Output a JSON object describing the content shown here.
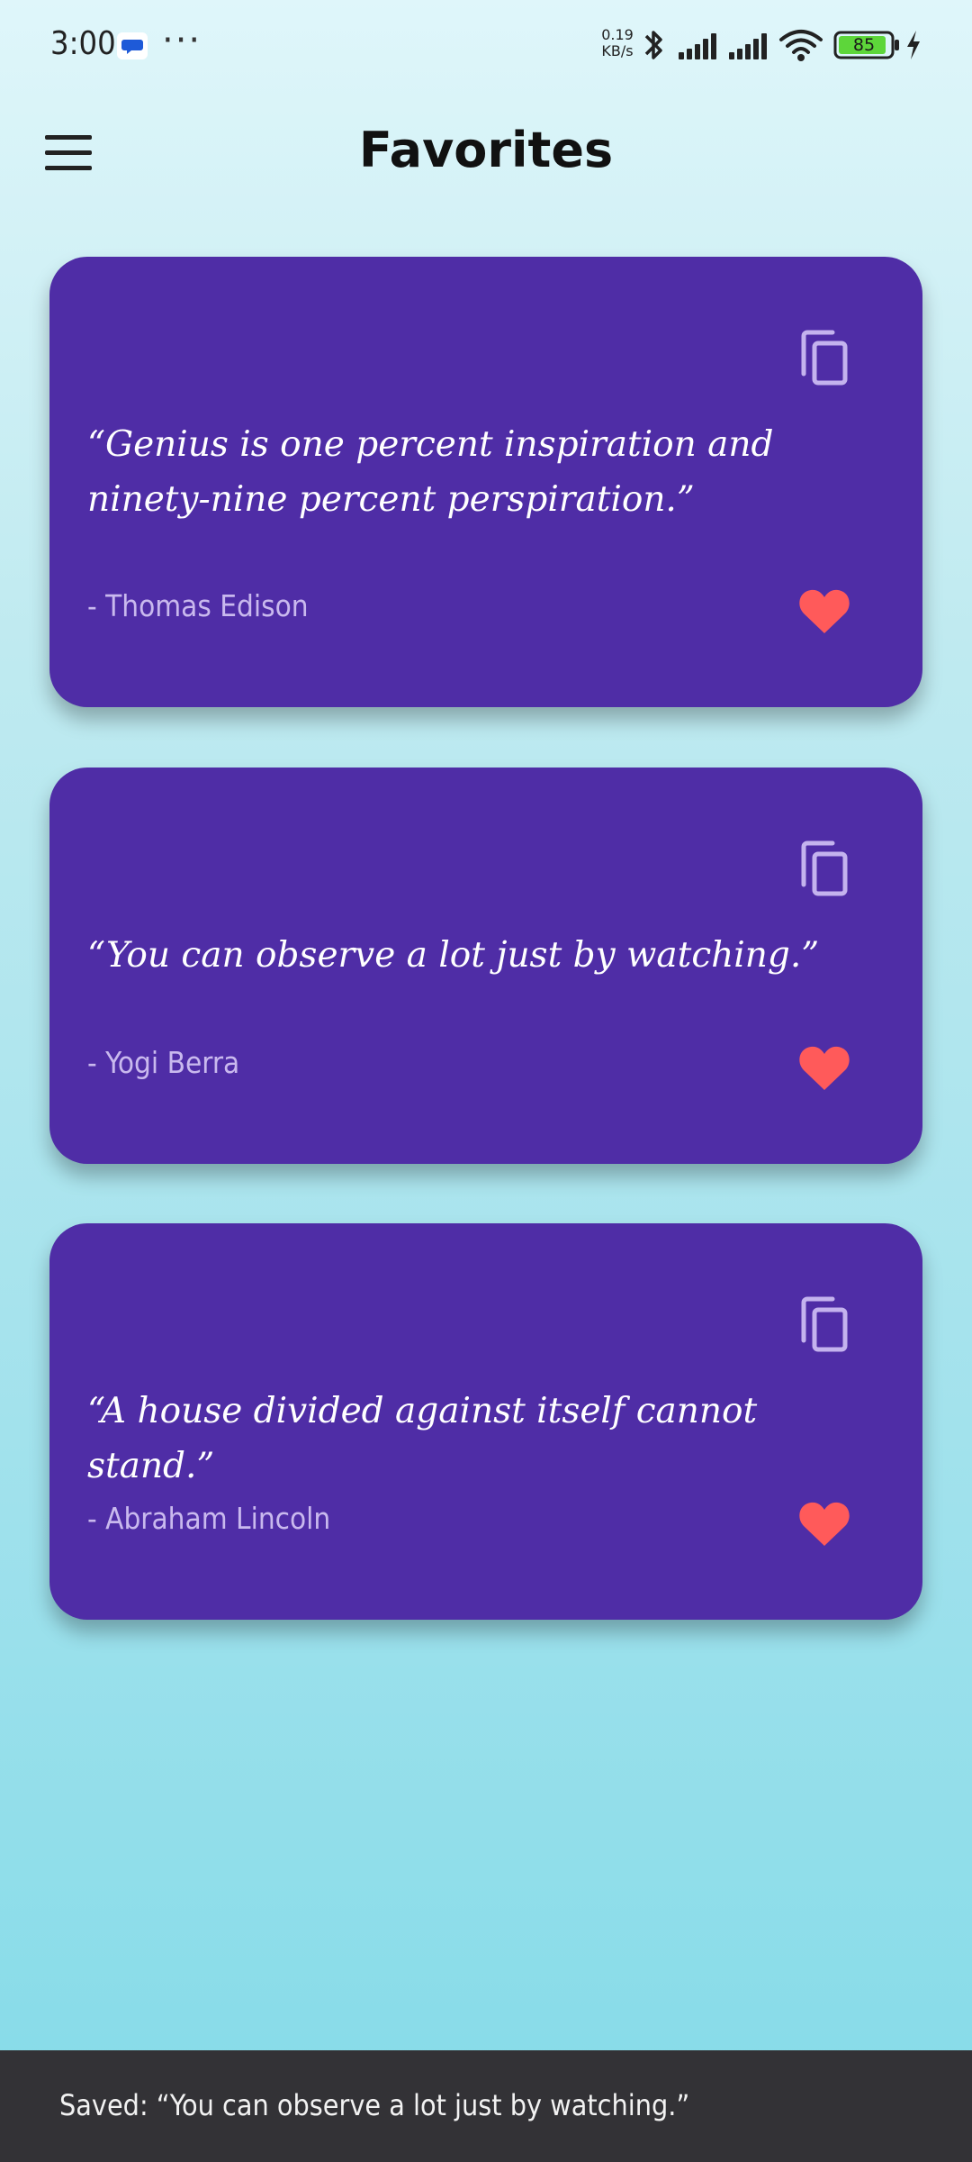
{
  "status_bar": {
    "time": "3:00",
    "more": "···",
    "net_speed_value": "0.19",
    "net_speed_unit": "KB/s",
    "battery": "85",
    "icons": [
      "chat-notification-icon",
      "bluetooth-icon",
      "signal-icon",
      "signal-icon",
      "wifi-icon",
      "battery-icon",
      "charging-icon"
    ]
  },
  "app_bar": {
    "title": "Favorites",
    "menu_icon": "hamburger-menu-icon"
  },
  "cards": [
    {
      "quote": "“Genius is one percent inspiration and ninety-nine percent perspiration.”",
      "author": "- Thomas Edison"
    },
    {
      "quote": "“You can observe a lot just by watching.”",
      "author": "- Yogi Berra"
    },
    {
      "quote": "“A house divided against itself cannot stand.”",
      "author": "- Abraham Lincoln"
    }
  ],
  "snackbar": {
    "text": "Saved: “You can observe a lot just by watching.”"
  },
  "colors": {
    "card": "#4f2da6",
    "heart": "#ff5a5a",
    "author_text": "#c9b9ee",
    "copy_icon": "#c4b3ee",
    "snackbar": "#333236"
  }
}
